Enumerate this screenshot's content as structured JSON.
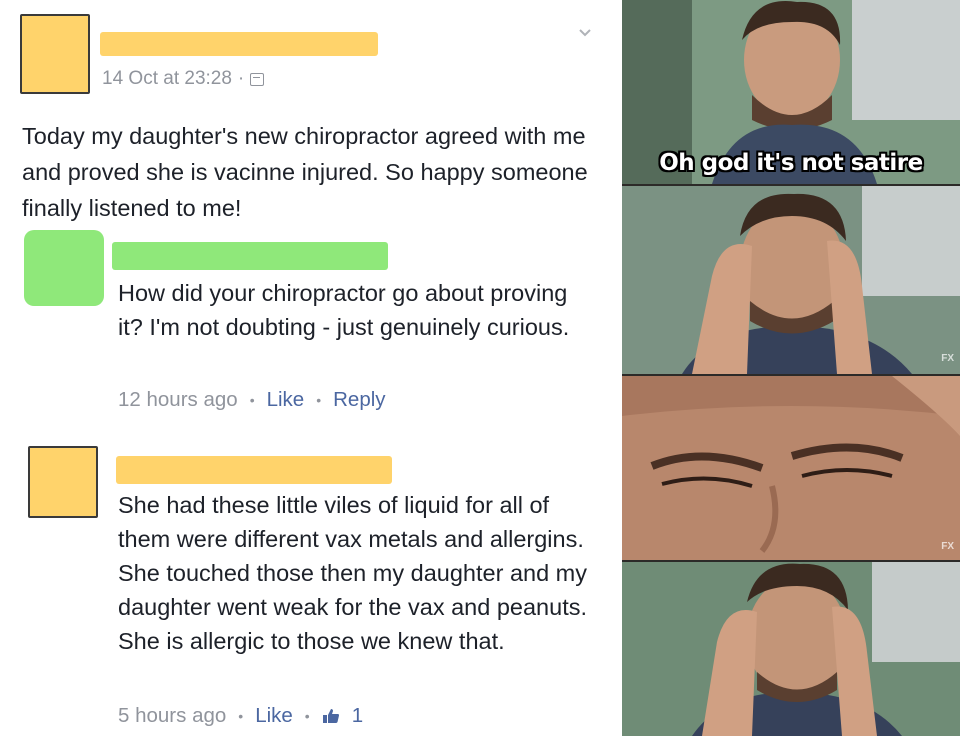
{
  "post": {
    "timestamp": "14 Oct at 23:28",
    "separator": "·",
    "text": "Today my daughter's new chiropractor agreed with me and proved she is vacinne injured. So happy someone finally listened to me!"
  },
  "comments": [
    {
      "text": "How did your chiropractor go about proving it? I'm not doubting - just genuinely curious.",
      "time": "12 hours ago",
      "like_label": "Like",
      "reply_label": "Reply"
    },
    {
      "text": "She had these little viles of liquid for all of them were different vax metals and allergins. She touched those then my daughter and my daughter went weak for the vax and peanuts. She is allergic to those we knew that.",
      "time": "5 hours ago",
      "like_label": "Like",
      "like_count": "1"
    }
  ],
  "meme": {
    "caption": "Oh god it's not satire",
    "watermark": "FX"
  },
  "colors": {
    "redact_yellow": "#ffd36b",
    "redact_green": "#8fe87a",
    "fb_link": "#4b67a1",
    "meta_gray": "#90949c"
  }
}
